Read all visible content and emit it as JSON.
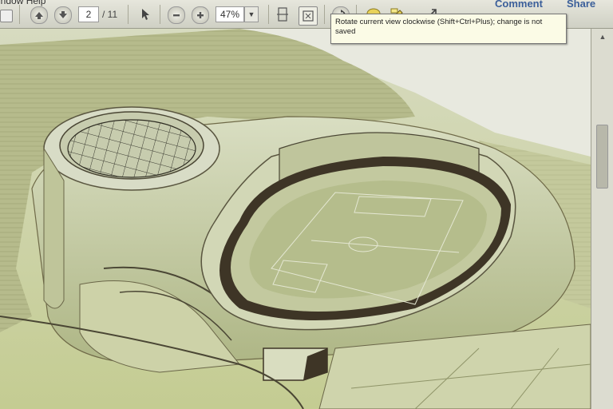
{
  "menu": {
    "fragment": "indow   Help"
  },
  "toolbar": {
    "current_page": "2",
    "page_total": "/ 11",
    "zoom": "47%",
    "comment_label": "Comment",
    "share_label": "Share",
    "icons": [
      "save-icon",
      "prev-page-icon",
      "next-page-icon",
      "select-tool-icon",
      "zoom-out-icon",
      "zoom-in-icon",
      "zoom-dropdown-icon",
      "fit-width-icon",
      "fit-page-icon",
      "rotate-clockwise-icon",
      "sticky-note-icon",
      "highlight-icon",
      "expand-icon"
    ]
  },
  "tooltip": {
    "text": "Rotate current view clockwise (Shift+Ctrl+Plus); change is not saved"
  },
  "colors": {
    "model_fill": "#c9cfa4",
    "model_dark": "#3e3526",
    "toolbar_bg": "#dcdcd0",
    "link": "#3b5f9a"
  }
}
